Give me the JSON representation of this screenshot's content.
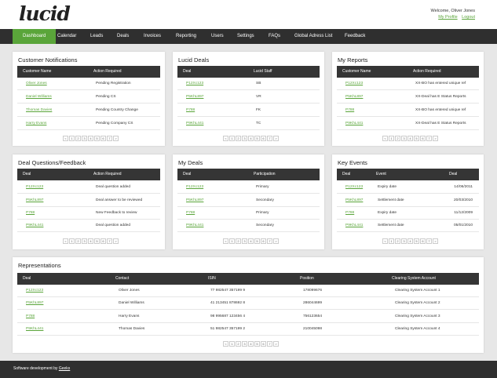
{
  "header": {
    "logo": "lucid",
    "welcome": "Welcome, Oliver Jones",
    "my_profile": "My Profile",
    "logout": "Logout"
  },
  "nav": {
    "items": [
      "Dashboard",
      "Calendar",
      "Leads",
      "Deals",
      "Invoices",
      "Reporting",
      "Users",
      "Settings",
      "FAQs",
      "Global Adress List",
      "Feedback"
    ],
    "active_color": "#5aa53a"
  },
  "customer_notifications": {
    "title": "Customer Notifications",
    "headers": [
      "Customer Name",
      "Action Required"
    ],
    "rows": [
      [
        "Oliver Jones",
        "Pending Registration"
      ],
      [
        "Daniel Williams",
        "Pending CS"
      ],
      [
        "Thomas Davies",
        "Pending Country Change"
      ],
      [
        "Harry Evans",
        "Pending Company CS"
      ]
    ]
  },
  "lucid_deals": {
    "title": "Lucid Deals",
    "headers": [
      "Deal",
      "Lucid Staff"
    ],
    "rows": [
      [
        "P12Xc123",
        "SB"
      ],
      [
        "P5KhL897",
        "VR"
      ],
      [
        "P788",
        "FK"
      ],
      [
        "P9KhL441",
        "TC"
      ]
    ]
  },
  "my_reports": {
    "title": "My Reports",
    "headers": [
      "Customer Name",
      "Action Required"
    ],
    "rows": [
      [
        "P12Xc123",
        "XX-BO has entered unique ref"
      ],
      [
        "P5KhL897",
        "XX-Deal has E Status Reports"
      ],
      [
        "P788",
        "XX-BO has entered unique ref"
      ],
      [
        "P9KhL441",
        "XX-Deal has E Status Reports"
      ]
    ]
  },
  "deal_questions": {
    "title": "Deal Questions/Feedback",
    "headers": [
      "Deal",
      "Action Required"
    ],
    "rows": [
      [
        "P12Xc123",
        "Deal question added"
      ],
      [
        "P5KhL897",
        "Deal answer to be reviewed"
      ],
      [
        "P788",
        "New Feedback to review"
      ],
      [
        "P9KhL441",
        "Deal question added"
      ]
    ]
  },
  "my_deals": {
    "title": "My Deals",
    "headers": [
      "Deal",
      "Participation"
    ],
    "rows": [
      [
        "P12Xc123",
        "Primary"
      ],
      [
        "P5KhL897",
        "Secondary"
      ],
      [
        "P788",
        "Primary"
      ],
      [
        "P9KhL441",
        "Secondary"
      ]
    ]
  },
  "key_events": {
    "title": "Key Events",
    "headers": [
      "Deal",
      "Event",
      "Deal"
    ],
    "rows": [
      [
        "P12Xc123",
        "Expiry date",
        "14/06/2011"
      ],
      [
        "P5KhL897",
        "Settlement date",
        "20/03/2010"
      ],
      [
        "P788",
        "Expiry date",
        "11/12/2009"
      ],
      [
        "P9KhL441",
        "Settlement date",
        "05/01/2010"
      ]
    ]
  },
  "representations": {
    "title": "Representations",
    "headers": [
      "Deal",
      "Contact",
      "ISIN",
      "Position",
      "Clearing System Account"
    ],
    "rows": [
      [
        "P12Xc123",
        "Oliver Jones",
        "77 982547 357199 9",
        "178099676",
        "Clearing System Account 1"
      ],
      [
        "P5KhL897",
        "Daniel Williams",
        "41 213451 878692 8",
        "286044699",
        "Clearing System Account 2"
      ],
      [
        "P788",
        "Harry Evans",
        "98 995687 123456 4",
        "756123654",
        "Clearing System Account 3"
      ],
      [
        "P9KhL441",
        "Thomas Davies",
        "51 982547 357199 2",
        "210045098",
        "Clearing System Account 4"
      ]
    ]
  },
  "pager": [
    "<",
    "1",
    "2",
    "3",
    "4",
    "5",
    "6",
    "7",
    ">"
  ],
  "footer": {
    "text": "Software development by",
    "link": "Geeks"
  }
}
